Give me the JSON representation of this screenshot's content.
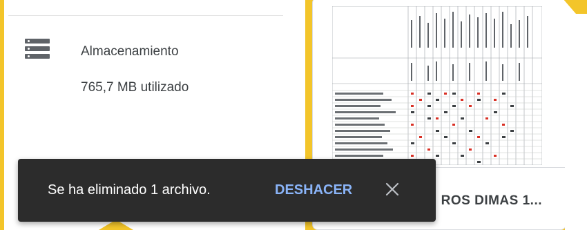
{
  "storage": {
    "title": "Almacenamiento",
    "used": "765,7 MB utilizado"
  },
  "file_card": {
    "name": "ROS DIMAS 1..."
  },
  "snackbar": {
    "message": "Se ha eliminado 1 archivo.",
    "undo_label": "DESHACER",
    "close_icon": "close-icon"
  },
  "colors": {
    "highlight": "#f3c52a",
    "snackbar_bg": "#2c2c2c",
    "undo": "#8ab4f8"
  }
}
